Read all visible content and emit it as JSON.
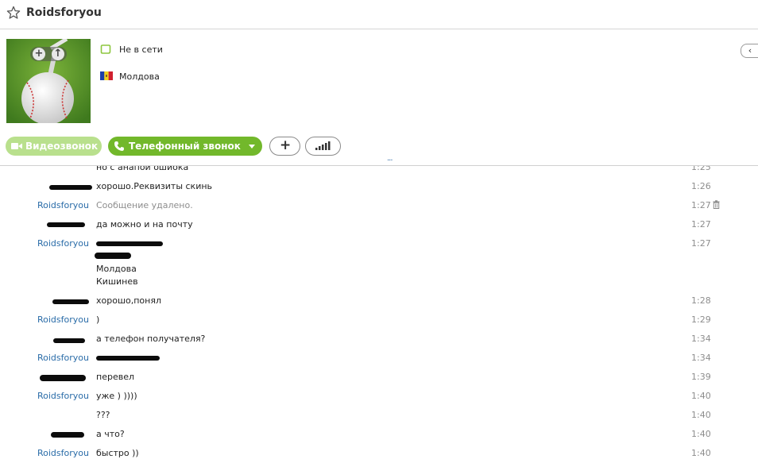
{
  "header": {
    "title": "Roidsforyou"
  },
  "profile": {
    "status": "Не в сети",
    "country": "Молдова",
    "collapse_glyph": "‹",
    "avatar_actions": [
      "+",
      "↑"
    ],
    "status_color": "#8dc63f"
  },
  "call_bar": {
    "video_call": "Видеозвонок",
    "phone_call": "Телефонный звонок",
    "add": "+",
    "video_color": "#b9e08d",
    "phone_color": "#72b82b"
  },
  "divider": {
    "dots": "···"
  },
  "chat": {
    "messages": [
      {
        "sender": "",
        "text": "но с анапой ошиока",
        "time": "1:25"
      },
      {
        "sender": "",
        "text": "хорошо.Реквизиты скинь",
        "time": "1:26"
      },
      {
        "sender": "Roidsforyou",
        "text": "Сообщение удалено.",
        "time": "1:27"
      },
      {
        "sender": "",
        "text": "да можно и на почту",
        "time": "1:27"
      },
      {
        "sender": "Roidsforyou",
        "text": "",
        "time": "1:27",
        "extra_lines": [
          "Молдова",
          "Кишинев"
        ]
      },
      {
        "sender": "",
        "text": "хорошо,понял",
        "time": "1:28"
      },
      {
        "sender": "Roidsforyou",
        "text": ")",
        "time": "1:29"
      },
      {
        "sender": "",
        "text": "а телефон получателя?",
        "time": "1:34"
      },
      {
        "sender": "Roidsforyou",
        "text": "",
        "time": "1:34"
      },
      {
        "sender": "",
        "text": "перевел",
        "time": "1:39"
      },
      {
        "sender": "Roidsforyou",
        "text": "уже ) ))))",
        "time": "1:40"
      },
      {
        "sender": "",
        "text": "???",
        "time": "1:40"
      },
      {
        "sender": "",
        "text": "а что?",
        "time": "1:40"
      },
      {
        "sender": "Roidsforyou",
        "text": "быстро ))",
        "time": "1:40"
      }
    ]
  },
  "icons": {
    "star": "star-icon",
    "status": "offline-status-icon",
    "flag": "moldova-flag-icon",
    "video": "video-camera-icon",
    "phone": "phone-icon",
    "signal": "signal-bars-icon",
    "trash": "trash-icon"
  }
}
